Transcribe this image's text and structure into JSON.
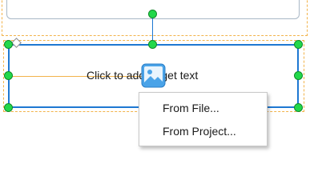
{
  "canvas": {
    "prompt_text": "Click to add target text"
  },
  "image_insert": {
    "icon": "image-icon"
  },
  "context_menu": {
    "items": [
      {
        "label": "From File..."
      },
      {
        "label": "From Project..."
      }
    ]
  },
  "colors": {
    "selection_border": "#1e78d2",
    "handle_fill": "#22d84a",
    "dashed_outline": "#f2b34a",
    "icon_fill": "#4aa3e8"
  }
}
